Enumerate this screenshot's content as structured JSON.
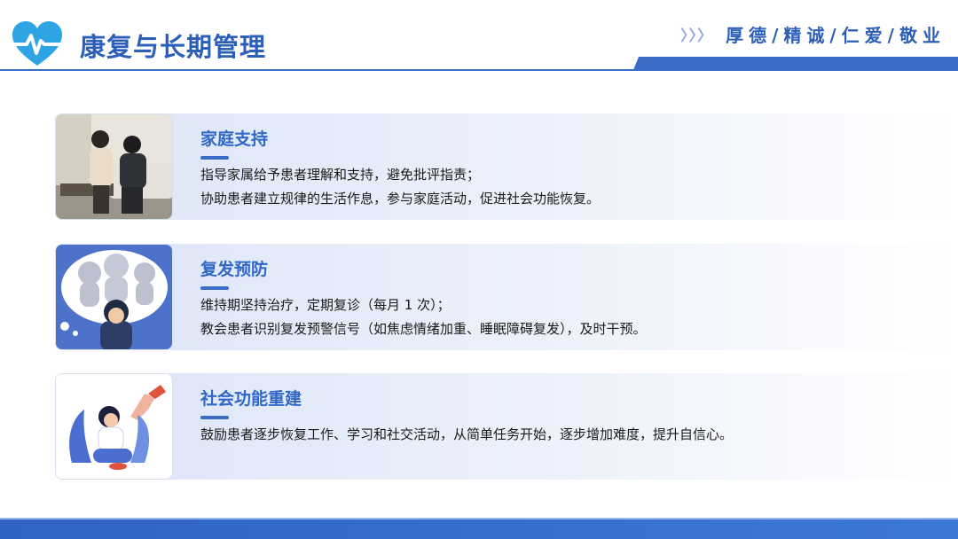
{
  "header": {
    "title": "康复与长期管理",
    "chevrons": "〉〉〉",
    "slogan": "厚德/精诚/仁爱/敬业",
    "logo_icon": "heart-pulse-icon",
    "accent_color": "#2c5fb8"
  },
  "cards": [
    {
      "title": "家庭支持",
      "image": "family-support-photo",
      "lines": [
        "指导家属给予患者理解和支持，避免批评指责；",
        "协助患者建立规律的生活作息，参与家庭活动，促进社会功能恢复。"
      ]
    },
    {
      "title": "复发预防",
      "image": "anxiety-illustration",
      "lines": [
        "维持期坚持治疗，定期复诊（每月 1 次）；",
        "教会患者识别复发预警信号（如焦虑情绪加重、睡眠障碍复发），及时干预。"
      ]
    },
    {
      "title": "社会功能重建",
      "image": "helping-hand-illustration",
      "lines": [
        "鼓励患者逐步恢复工作、学习和社交活动，从简单任务开始，逐步增加难度，提升自信心。"
      ]
    }
  ]
}
